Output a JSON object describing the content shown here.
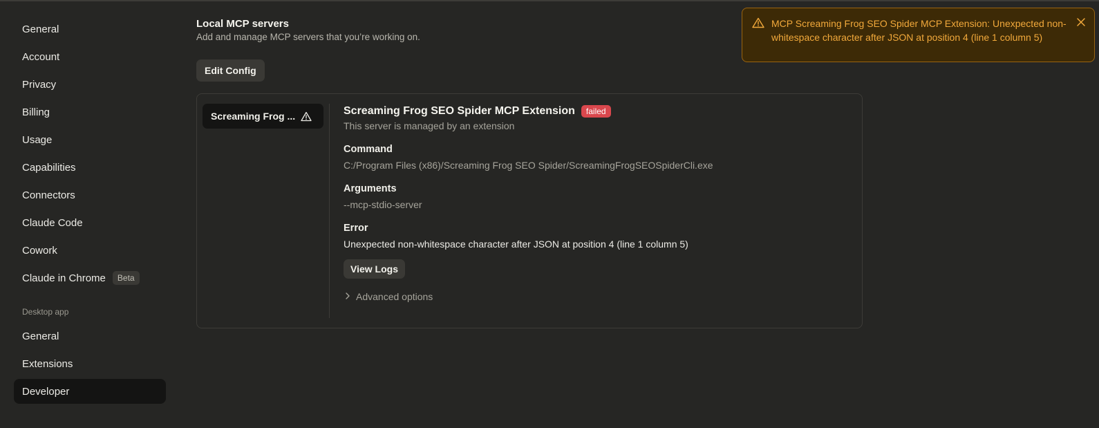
{
  "sidebar": {
    "items": [
      {
        "label": "General"
      },
      {
        "label": "Account"
      },
      {
        "label": "Privacy"
      },
      {
        "label": "Billing"
      },
      {
        "label": "Usage"
      },
      {
        "label": "Capabilities"
      },
      {
        "label": "Connectors"
      },
      {
        "label": "Claude Code"
      },
      {
        "label": "Cowork"
      },
      {
        "label": "Claude in Chrome",
        "badge": "Beta"
      }
    ],
    "desktop_section_label": "Desktop app",
    "desktop_items": [
      {
        "label": "General"
      },
      {
        "label": "Extensions"
      },
      {
        "label": "Developer",
        "active": true
      }
    ]
  },
  "main": {
    "title": "Local MCP servers",
    "subtitle": "Add and manage MCP servers that you’re working on.",
    "edit_config_label": "Edit Config",
    "server_list": [
      {
        "label": "Screaming Frog ...",
        "icon": "warning-icon"
      }
    ],
    "detail": {
      "title": "Screaming Frog SEO Spider MCP Extension",
      "status": "failed",
      "managed_note": "This server is managed by an extension",
      "command_label": "Command",
      "command_value": "C:/Program Files (x86)/Screaming Frog SEO Spider/ScreamingFrogSEOSpiderCli.exe",
      "arguments_label": "Arguments",
      "arguments_value": "--mcp-stdio-server",
      "error_label": "Error",
      "error_value": "Unexpected non-whitespace character after JSON at position 4 (line 1 column 5)",
      "view_logs_label": "View Logs",
      "advanced_label": "Advanced options"
    }
  },
  "toast": {
    "message": "MCP Screaming Frog SEO Spider MCP Extension: Unexpected non-whitespace character after JSON at position 4 (line 1 column 5)",
    "icon": "warning-icon",
    "close_icon": "close-icon"
  },
  "colors": {
    "background": "#262624",
    "failed": "#d9474d",
    "toast_text": "#f2a93b",
    "toast_bg": "#3d2a06"
  }
}
